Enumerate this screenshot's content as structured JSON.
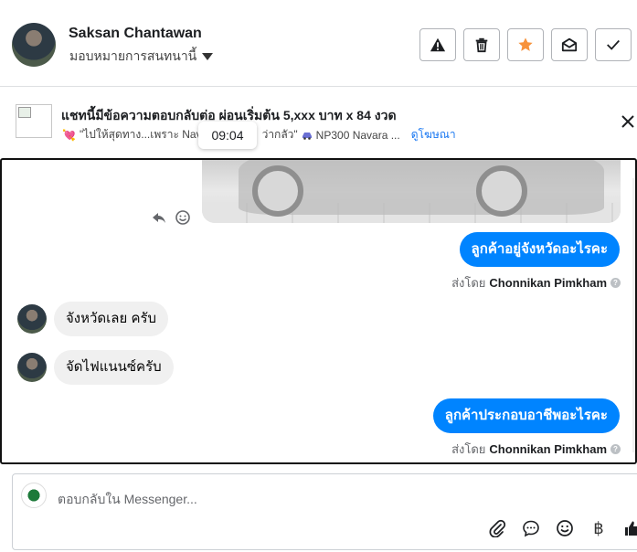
{
  "header": {
    "customer_name": "Saksan Chantawan",
    "assign_label": "มอบหมายการสนทนานี้",
    "actions": [
      "alert-icon",
      "trash-icon",
      "star-icon",
      "mail-open-icon",
      "check-icon"
    ],
    "star_color": "#f7923b"
  },
  "ad": {
    "title": "แชทนี้มีข้อความตอบกลับต่อ ผ่อนเริ่มต้น 5,xxx บาท x 84 งวด",
    "subtitle_emoji": "💘",
    "subtitle_text": "\"ไปให้สุดทาง...เพราะ Nav",
    "subtitle_text_2": "ว่ากลัว\"",
    "subtitle_car": "NP300 Navara ...",
    "view_ad_link": "ดูโฆษณา"
  },
  "tooltip_time": "09:04",
  "messages": {
    "out_1": "ลูกค้าอยู่จังหวัดอะไรคะ",
    "sent_by_prefix": "ส่งโดย",
    "sent_by_name": "Chonnikan Pimkham",
    "in_1": "จังหวัดเลย ครับ",
    "in_2": "จัดไฟแนนซ์ครับ",
    "out_2": "ลูกค้าประกอบอาชีพอะไรคะ"
  },
  "composer": {
    "placeholder": "ตอบกลับใน Messenger...",
    "tools": [
      "paperclip-icon",
      "chat-bubble-icon",
      "emoji-icon",
      "baht-icon",
      "thumbs-up-icon"
    ],
    "baht_symbol": "฿"
  },
  "colors": {
    "accent": "#0084ff",
    "link": "#1877f2",
    "incoming_bubble": "#f0f0f0"
  }
}
